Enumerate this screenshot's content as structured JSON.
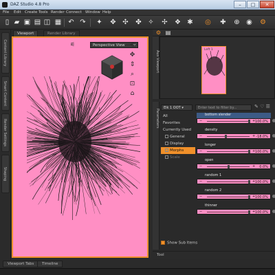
{
  "window": {
    "title": "DAZ Studio 4.8 Pro",
    "min": "–",
    "max": "□",
    "close": "✕"
  },
  "menu": [
    "File",
    "Edit",
    "Create",
    "Tools",
    "Render",
    "Connect",
    "Window",
    "Help"
  ],
  "left_tabs": [
    "Content Library",
    "Smart Content",
    "Render Settings",
    "Shaping"
  ],
  "viewport": {
    "tabs": [
      "Viewport",
      "Render Library"
    ],
    "camera": "Perspective View"
  },
  "aux": {
    "tab": "Aux Viewport",
    "mini_label": "Left 1"
  },
  "params": {
    "tab": "Parameters",
    "node": "Elk 1 OOT",
    "filter_placeholder": "Enter text to filter by...",
    "categories": [
      "All",
      "Favorites",
      "Currently Used",
      "General",
      "Display",
      "Morphs",
      "Scale"
    ],
    "selected_category": "Morphs",
    "properties": [
      {
        "name": "bottom slender",
        "value": "100.0%"
      },
      {
        "name": "density",
        "value": "-18.0%"
      },
      {
        "name": "longer",
        "value": "100.0%"
      },
      {
        "name": "open",
        "value": "0.0%"
      },
      {
        "name": "random 1",
        "value": "100.0%"
      },
      {
        "name": "random 2",
        "value": "100.0%"
      },
      {
        "name": "thinner",
        "value": "100.0%"
      }
    ],
    "show_sub_items": "Show Sub Items"
  },
  "bottom": {
    "left_tabs": [
      "Viewport Tabs",
      "Timeline"
    ],
    "tool_tab": "Tool"
  },
  "colors": {
    "viewport_bg": "#ff8fc4",
    "accent": "#f0902a",
    "highlight_row": "#3d5b86"
  }
}
